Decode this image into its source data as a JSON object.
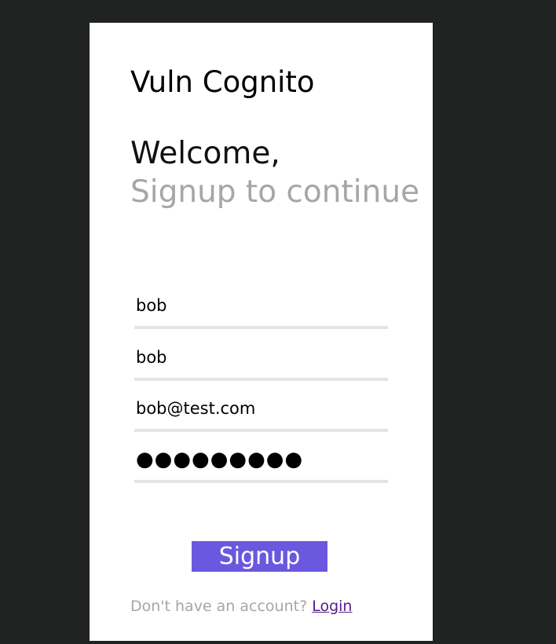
{
  "app": {
    "title": "Vuln Cognito"
  },
  "heading": {
    "welcome": "Welcome,",
    "subtitle": "Signup to continue"
  },
  "form": {
    "name_value": "bob",
    "surname_value": "bob",
    "email_value": "bob@test.com",
    "password_value": "●●●●●●●●●",
    "signup_label": "Signup"
  },
  "footer": {
    "prompt": "Don't have an account?",
    "login_label": "Login"
  },
  "colors": {
    "page_background": "#212222",
    "card_background": "#ffffff",
    "accent": "#6b58de",
    "link": "#551a8b",
    "muted_text": "#a6a6a6",
    "field_underline": "#e4e4e4"
  }
}
